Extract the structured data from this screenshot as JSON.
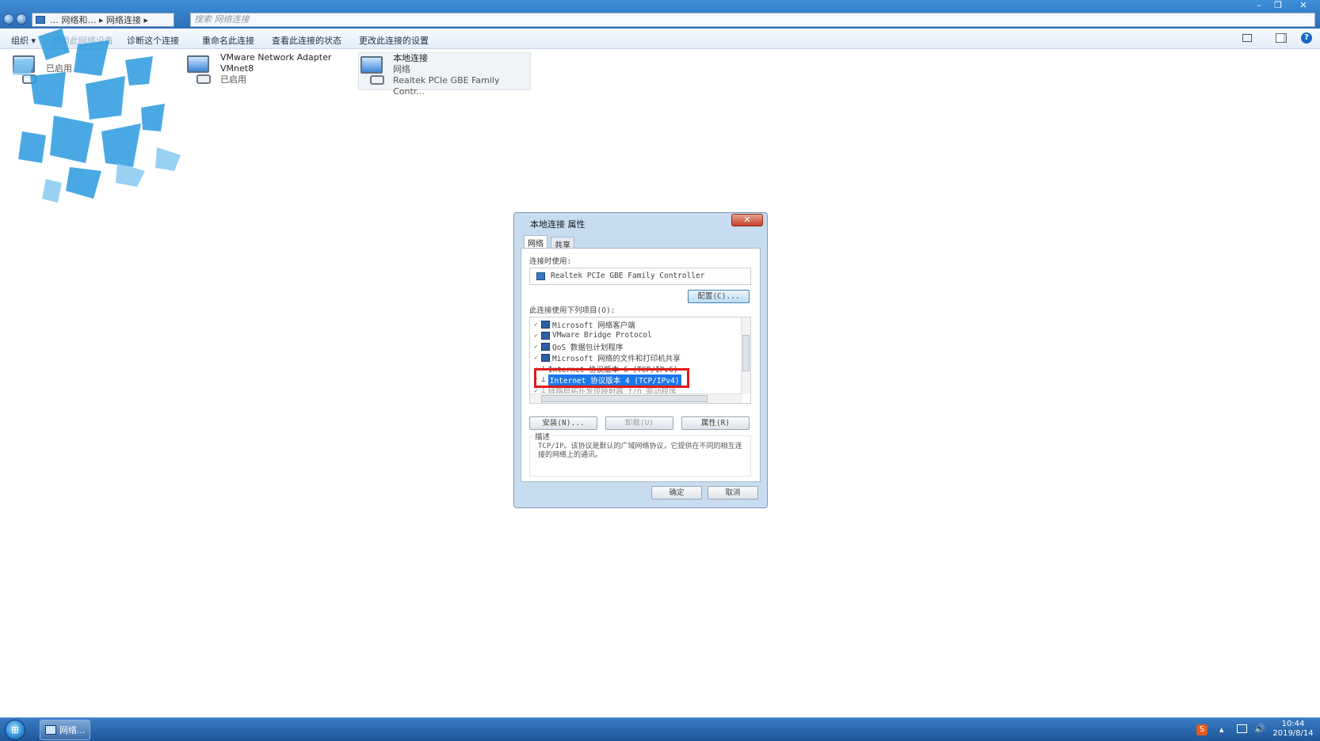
{
  "window": {
    "breadcrumb": "… 网络和… ▸ 网络连接 ▸",
    "search_placeholder": "搜索 网络连接",
    "controls": {
      "minimize": "–",
      "restore": "❐",
      "close": "✕"
    }
  },
  "cmdbar": {
    "items": [
      "组织 ▾",
      "禁用此网络设备",
      "诊断这个连接",
      "重命名此连接",
      "查看此连接的状态",
      "更改此连接的设置"
    ],
    "help": "?"
  },
  "connections": [
    {
      "name": "",
      "line2": "",
      "status": "已启用"
    },
    {
      "name": "VMware Network Adapter",
      "line2": "VMnet8",
      "status": "已启用"
    },
    {
      "name": "本地连接",
      "line2": "网络",
      "status": "Realtek PCIe GBE Family Contr..."
    }
  ],
  "dialog": {
    "title": "本地连接 属性",
    "close": "✕",
    "tabs": [
      "网络",
      "共享"
    ],
    "connect_using_label": "连接时使用:",
    "adapter": "Realtek PCIe GBE Family Controller",
    "configure_button": "配置(C)...",
    "items_label": "此连接使用下列项目(O):",
    "items": [
      {
        "check": "✓",
        "label": "Microsoft 网络客户端"
      },
      {
        "check": "✓",
        "label": "VMware Bridge Protocol"
      },
      {
        "check": "✓",
        "label": "QoS 数据包计划程序"
      },
      {
        "check": "✓",
        "label": "Microsoft 网络的文件和打印机共享"
      },
      {
        "check": "✓",
        "label": "Internet 协议版本 6 (TCP/IPv6)"
      },
      {
        "check": "✓",
        "label": "Internet 协议版本 4 (TCP/IPv4)"
      },
      {
        "check": "✓",
        "label": "链路层拓扑发现映射器 I/O 驱动程序"
      }
    ],
    "install_button": "安装(N)...",
    "uninstall_button": "卸载(U)",
    "properties_button": "属性(R)",
    "description_legend": "描述",
    "description_text": "TCP/IP。该协议是默认的广域网络协议，它提供在不同的相互连接的网络上的通讯。",
    "ok_button": "确定",
    "cancel_button": "取消"
  },
  "taskbar": {
    "start": "⊞",
    "task_label": "网络...",
    "ime": "S",
    "tray_arrow": "▴",
    "volume": "🔊",
    "time": "10:44",
    "date": "2019/8/14"
  },
  "colors": {
    "highlight_border": "#e01b1b",
    "selection": "#1c77e8",
    "titlebar": "#2b6fb8"
  }
}
